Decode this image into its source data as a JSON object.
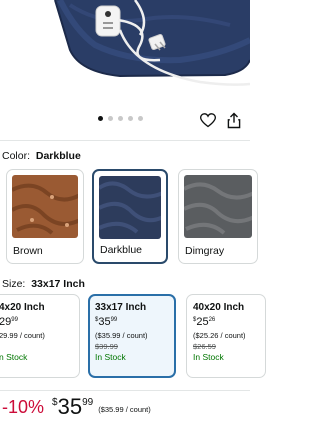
{
  "carousel": {
    "dot_count": 5,
    "active_index": 0
  },
  "icons": {
    "wishlist": "heart-icon",
    "share": "share-icon"
  },
  "color": {
    "label": "Color:",
    "selected": "Darkblue",
    "options": [
      {
        "name": "Brown"
      },
      {
        "name": "Darkblue"
      },
      {
        "name": "Dimgray"
      }
    ]
  },
  "size": {
    "label": "Size:",
    "selected": "33x17 Inch",
    "options": [
      {
        "title": "4x20 Inch",
        "price_whole": "29",
        "price_fraction": "99",
        "unit_price": "29.99 / count)",
        "stock": "n Stock"
      },
      {
        "title": "33x17 Inch",
        "price_currency": "$",
        "price_whole": "35",
        "price_fraction": "99",
        "unit_price": "($35.99 / count)",
        "list_price": "$39.99",
        "stock": "In Stock"
      },
      {
        "title": "40x20 Inch",
        "price_currency": "$",
        "price_whole": "25",
        "price_fraction": "26",
        "unit_price": "($25.26 / count)",
        "list_price": "$26.59",
        "stock": "In Stock"
      }
    ]
  },
  "price": {
    "discount": "-10%",
    "currency": "$",
    "whole": "35",
    "fraction": "99",
    "unit_price": "($35.99 / count)"
  },
  "colors": {
    "deal_red": "#cc0c39",
    "in_stock_green": "#007600",
    "selected_border": "#2a6fa8"
  }
}
